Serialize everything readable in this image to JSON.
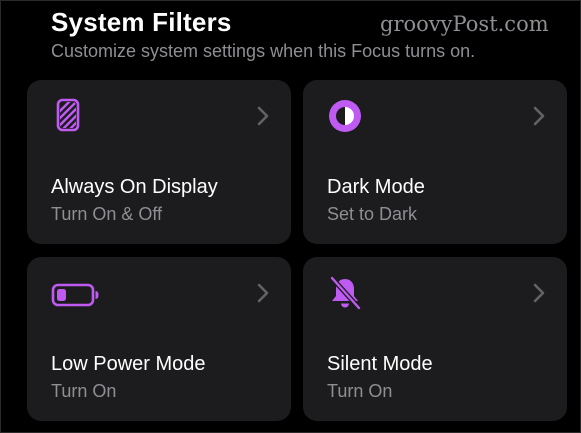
{
  "header": {
    "title": "System Filters",
    "subtitle": "Customize system settings when this Focus turns on."
  },
  "watermark": "groovyPost.com",
  "colors": {
    "background": "#000000",
    "tile": "#1c1c1e",
    "accent": "#bf5af2",
    "secondary_text": "#8e8e93",
    "chevron": "#636366"
  },
  "filters": [
    {
      "label": "Always On Display",
      "status": "Turn On & Off",
      "icon": "always-on-display-icon"
    },
    {
      "label": "Dark Mode",
      "status": "Set to Dark",
      "icon": "dark-mode-icon"
    },
    {
      "label": "Low Power Mode",
      "status": "Turn On",
      "icon": "battery-icon"
    },
    {
      "label": "Silent Mode",
      "status": "Turn On",
      "icon": "bell-slash-icon"
    }
  ]
}
